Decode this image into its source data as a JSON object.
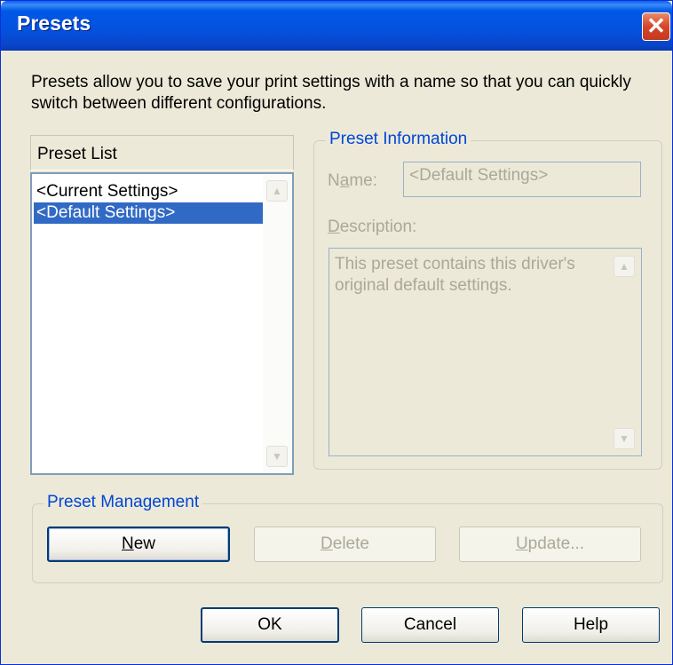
{
  "window": {
    "title": "Presets",
    "close_glyph": "✕"
  },
  "description": "Presets allow you to save your print settings with a name so that you can quickly switch between different configurations.",
  "preset_list": {
    "header": "Preset List",
    "items": [
      {
        "label": "<Current Settings>",
        "selected": false
      },
      {
        "label": "<Default Settings>",
        "selected": true
      }
    ]
  },
  "preset_information": {
    "legend": "Preset Information",
    "name_label_pre": "N",
    "name_label_mn": "a",
    "name_label_post": "me:",
    "name_value": "<Default Settings>",
    "description_label_mn": "D",
    "description_label_post": "escription:",
    "description_value": "This preset contains this driver's original default settings."
  },
  "preset_management": {
    "legend": "Preset Management",
    "new_mn": "N",
    "new_rest": "ew",
    "delete_mn": "D",
    "delete_rest": "elete",
    "update_mn": "U",
    "update_rest": "pdate..."
  },
  "footer": {
    "ok": "OK",
    "cancel": "Cancel",
    "help": "Help"
  },
  "colors": {
    "accent": "#0046d5",
    "selection": "#316ac5",
    "titlebar": "#0058e6",
    "close": "#d6452a"
  },
  "icons": {
    "close": "close-icon",
    "scroll_up": "chevron-up-icon",
    "scroll_down": "chevron-down-icon"
  }
}
